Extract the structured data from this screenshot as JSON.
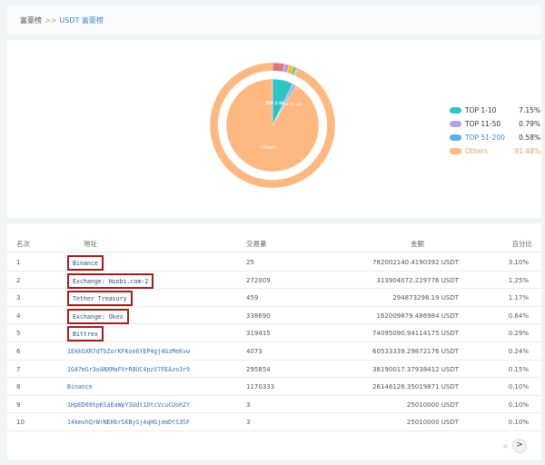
{
  "breadcrumb": {
    "home": "富豪榜",
    "separator": ">>",
    "current": "USDT 富豪榜"
  },
  "chart": {
    "slice_labels": {
      "top1_10": "TOP 1-10",
      "top51_200": "TOP 51-200"
    },
    "others_label": "Others"
  },
  "chart_data": {
    "type": "pie",
    "categories": [
      "TOP 1-10",
      "TOP 11-50",
      "TOP 51-200",
      "Others"
    ],
    "values": [
      7.15,
      0.79,
      0.58,
      91.48
    ],
    "colors": [
      "#2ec4c6",
      "#b6a2de",
      "#5ab1ef",
      "#ffb980"
    ],
    "legend": "right",
    "outer_ring_colors": [
      "#d87a80",
      "#b6a2de",
      "#e5cf0d",
      "#8d98b3",
      "#97b552",
      "#5ab1ef",
      "#ffb980"
    ],
    "outer_ring_values": [
      3.1,
      1.25,
      1.17,
      0.64,
      0.29,
      0.24,
      93.31
    ]
  },
  "legend": {
    "items": [
      {
        "label": "TOP 1-10",
        "value": "7.15%",
        "color": "#2ec4c6",
        "label_color": "#333333"
      },
      {
        "label": "TOP 11-50",
        "value": "0.79%",
        "color": "#b6a2de",
        "label_color": "#333333"
      },
      {
        "label": "TOP 51-200",
        "value": "0.58%",
        "color": "#5ab1ef",
        "label_color": "#3d8bd7"
      },
      {
        "label": "Others",
        "value": "91.48%",
        "color": "#ffb980",
        "label_color": "#e8a064"
      }
    ]
  },
  "table": {
    "headers": {
      "rank": "名次",
      "address": "地址",
      "tx": "交易量",
      "amount": "金额",
      "pct": "百分比"
    },
    "rows": [
      {
        "rank": "1",
        "address": "Binance",
        "tx": "25",
        "amount": "782002140.4190392 USDT",
        "pct": "3.10%",
        "boxed": true
      },
      {
        "rank": "2",
        "address": "Exchange: Huobi.com-2",
        "tx": "272009",
        "amount": "313904072.229776 USDT",
        "pct": "1.25%",
        "boxed": true
      },
      {
        "rank": "3",
        "address": "Tether Treasury",
        "tx": "459",
        "amount": "294873298.19 USDT",
        "pct": "1.17%",
        "boxed": true
      },
      {
        "rank": "4",
        "address": "Exchange: Okex",
        "tx": "338690",
        "amount": "162009879.486984 USDT",
        "pct": "0.64%",
        "boxed": true
      },
      {
        "rank": "5",
        "address": "Bittrex",
        "tx": "319415",
        "amount": "74095090.94114175 USDT",
        "pct": "0.29%",
        "boxed": true
      },
      {
        "rank": "6",
        "address": "1EkkGXR7dTbZorKFKoe6YEP4gj4GzMeKvw",
        "tx": "4073",
        "amount": "60533339.29872176 USDT",
        "pct": "0.24%",
        "boxed": false
      },
      {
        "rank": "7",
        "address": "1G47mSr3oANXMaFVrR8UC4pzV7FEAzo3r9",
        "tx": "295854",
        "amount": "38190017.37938412 USDT",
        "pct": "0.15%",
        "boxed": false
      },
      {
        "rank": "8",
        "address": "Binance",
        "tx": "1170333",
        "amount": "26146126.35019871 USDT",
        "pct": "0.10%",
        "boxed": false
      },
      {
        "rank": "9",
        "address": "1HpED69tpKSaEaWpY3Udt1DtcVcuCUoh2Y",
        "tx": "3",
        "amount": "25010000 USDT",
        "pct": "0.10%",
        "boxed": false
      },
      {
        "rank": "10",
        "address": "14kmvhQrWrNEHbrSKBySj4qHGjemDtS3SF",
        "tx": "3",
        "amount": "25010000 USDT",
        "pct": "0.10%",
        "boxed": false
      }
    ]
  },
  "pager": {
    "prev": "<",
    "next": ">"
  }
}
